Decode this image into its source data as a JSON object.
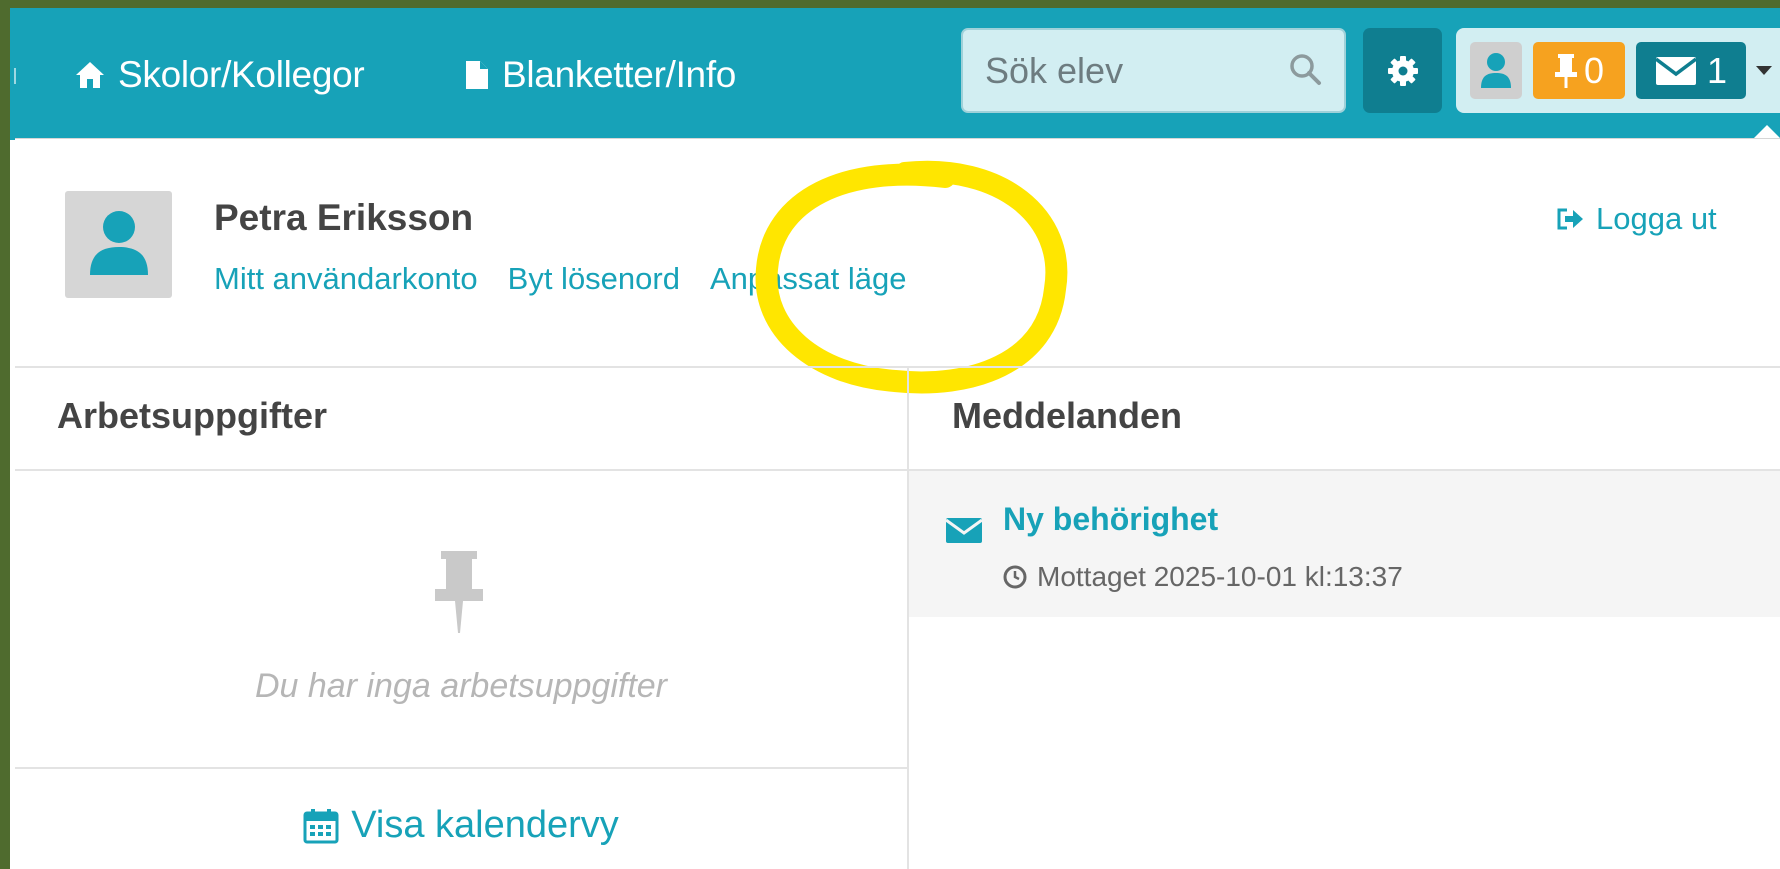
{
  "navbar": {
    "schools_label": "Skolor/Kollegor",
    "forms_label": "Blanketter/Info",
    "search_placeholder": "Sök elev",
    "tasks_count": "0",
    "messages_count": "1"
  },
  "user": {
    "name": "Petra Eriksson",
    "account_link": "Mitt användarkonto",
    "password_link": "Byt lösenord",
    "adapted_mode_link": "Anpassat läge",
    "logout_label": "Logga ut"
  },
  "tasks": {
    "title": "Arbetsuppgifter",
    "empty_text": "Du har inga arbetsuppgifter",
    "calendar_link": "Visa kalendervy"
  },
  "messages": {
    "title": "Meddelanden",
    "items": [
      {
        "subject": "Ny behörighet",
        "received": "Mottaget 2025-10-01 kl:13:37"
      }
    ]
  },
  "colors": {
    "primary": "#17a2b8",
    "primary_dark": "#0f7e90",
    "warning": "#f6a21f",
    "highlight": "#ffe600"
  },
  "icons": {
    "schools": "home-icon",
    "forms": "file-icon",
    "search": "search-icon",
    "settings": "gear-icon",
    "user": "user-icon",
    "tasks": "pin-icon",
    "messages": "envelope-icon",
    "logout": "sign-out-icon",
    "calendar": "calendar-icon",
    "time": "clock-icon"
  }
}
